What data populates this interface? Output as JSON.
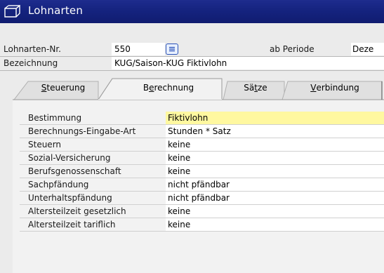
{
  "window": {
    "title": "Lohnarten"
  },
  "header": {
    "nr_label": "Lohnarten-Nr.",
    "nr_value": "550",
    "period_label": "ab Periode",
    "period_value": "Deze",
    "bez_label": "Bezeichnung",
    "bez_value": "KUG/Saison-KUG Fiktivlohn"
  },
  "tabs": [
    {
      "label_pre": "",
      "label_u": "S",
      "label_post": "teuerung",
      "active": false
    },
    {
      "label_pre": "B",
      "label_u": "e",
      "label_post": "rechnung",
      "active": true
    },
    {
      "label_pre": "Sä",
      "label_u": "t",
      "label_post": "ze",
      "active": false
    },
    {
      "label_pre": "",
      "label_u": "V",
      "label_post": "erbindung",
      "active": false
    }
  ],
  "fields": [
    {
      "label": "Bestimmung",
      "value": "Fiktivlohn",
      "active": true
    },
    {
      "label": "Berechnungs-Eingabe-Art",
      "value": "Stunden * Satz",
      "active": false
    },
    {
      "label": "Steuern",
      "value": "keine",
      "active": false
    },
    {
      "label": "Sozial-Versicherung",
      "value": "keine",
      "active": false
    },
    {
      "label": "Berufsgenossenschaft",
      "value": "keine",
      "active": false
    },
    {
      "label": "Sachpfändung",
      "value": "nicht pfändbar",
      "active": false
    },
    {
      "label": "Unterhaltspfändung",
      "value": "nicht pfändbar",
      "active": false
    },
    {
      "label": "Altersteilzeit gesetzlich",
      "value": "keine",
      "active": false
    },
    {
      "label": "Altersteilzeit tariflich",
      "value": "keine",
      "active": false
    }
  ],
  "colors": {
    "titlebar": "#15237f",
    "active_field": "#fff8a0",
    "window_bg": "#ebebeb"
  },
  "icons": {
    "window": "form-window-icon",
    "list": "choose-from-list-icon"
  }
}
